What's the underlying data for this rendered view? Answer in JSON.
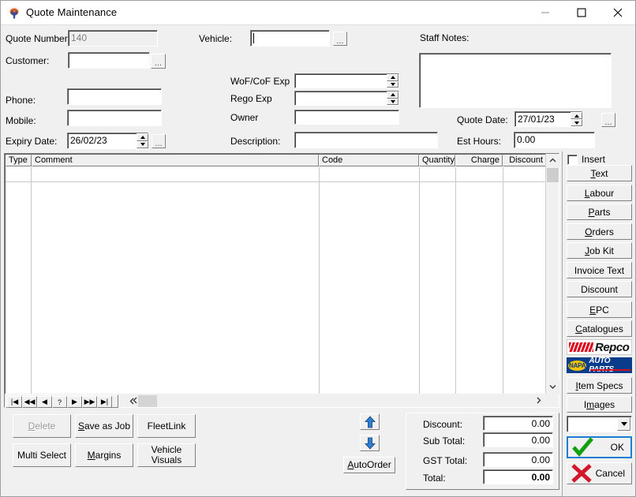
{
  "window": {
    "title": "Quote Maintenance",
    "icon": "app-emblem-icon",
    "minimize": "—",
    "maximize": "□",
    "close": "✕"
  },
  "form": {
    "quote_number": {
      "label": "Quote Number:",
      "value": "140"
    },
    "customer": {
      "label": "Customer:",
      "value": ""
    },
    "phone": {
      "label": "Phone:",
      "value": ""
    },
    "mobile": {
      "label": "Mobile:",
      "value": ""
    },
    "expiry_date": {
      "label": "Expiry Date:",
      "value": "26/02/23"
    },
    "vehicle": {
      "label": "Vehicle:",
      "value": ""
    },
    "wof_cof_exp": {
      "label": "WoF/CoF Exp",
      "value": ""
    },
    "rego_exp": {
      "label": "Rego Exp",
      "value": ""
    },
    "owner": {
      "label": "Owner",
      "value": ""
    },
    "description": {
      "label": "Description:",
      "value": ""
    },
    "staff_notes": {
      "label": "Staff Notes:",
      "value": ""
    },
    "quote_date": {
      "label": "Quote Date:",
      "value": "27/01/23"
    },
    "est_hours": {
      "label": "Est Hours:",
      "value": "0.00"
    },
    "browse_button": "..."
  },
  "grid": {
    "columns": [
      {
        "label": "Type",
        "align": "left"
      },
      {
        "label": "Comment",
        "align": "left"
      },
      {
        "label": "Code",
        "align": "left"
      },
      {
        "label": "Quantity",
        "align": "right"
      },
      {
        "label": "Charge",
        "align": "right"
      },
      {
        "label": "Discount",
        "align": "right"
      }
    ],
    "rows": []
  },
  "nav": {
    "first": "|◀",
    "prev_page": "◀◀",
    "prev": "◀",
    "help": "?",
    "next": "▶",
    "next_page": "▶▶",
    "last": "▶|"
  },
  "actions": {
    "delete": "Delete",
    "save_as_job": "Save as Job",
    "fleetlink": "FleetLink",
    "multi_select": "Multi Select",
    "margins": "Margins",
    "vehicle_visuals_line1": "Vehicle",
    "vehicle_visuals_line2": "Visuals",
    "autoorder": "AutoOrder",
    "move_up": "move-up-arrow",
    "move_down": "move-down-arrow"
  },
  "totals": {
    "discount": {
      "label": "Discount:",
      "value": "0.00"
    },
    "sub_total": {
      "label": "Sub Total:",
      "value": "0.00"
    },
    "gst_total": {
      "label": "GST Total:",
      "value": "0.00"
    },
    "total": {
      "label": "Total:",
      "value": "0.00"
    }
  },
  "side_panel": {
    "insert_label": "Insert",
    "insert_checked": false,
    "buttons": [
      {
        "label": "Text",
        "accel": "T"
      },
      {
        "label": "Labour",
        "accel": "L"
      },
      {
        "label": "Parts",
        "accel": "P"
      },
      {
        "label": "Orders",
        "accel": "O"
      },
      {
        "label": "Job Kit",
        "accel": "J"
      },
      {
        "label": "Invoice Text",
        "accel": ""
      },
      {
        "label": "Discount",
        "accel": ""
      },
      {
        "label": "EPC",
        "accel": "E"
      },
      {
        "label": "Catalogues",
        "accel": "C"
      }
    ],
    "logos": [
      {
        "name": "repco-logo",
        "text": "Repco"
      },
      {
        "name": "napa-logo",
        "text": "AUTO PARTS",
        "badge": "NAPA"
      }
    ],
    "buttons2": [
      {
        "label": "Item Specs",
        "accel": "I"
      },
      {
        "label": "Images",
        "accel": "m"
      }
    ],
    "combo_value": "",
    "ok": "OK",
    "cancel": "Cancel"
  },
  "colors": {
    "face": "#f0f0f0",
    "focus_border": "#1a7fd4",
    "ok_check": "#13a010",
    "cancel_x": "#d2182a",
    "repco_red": "#e00018",
    "napa_blue": "#0a3c8c",
    "napa_yellow": "#f2c300"
  }
}
